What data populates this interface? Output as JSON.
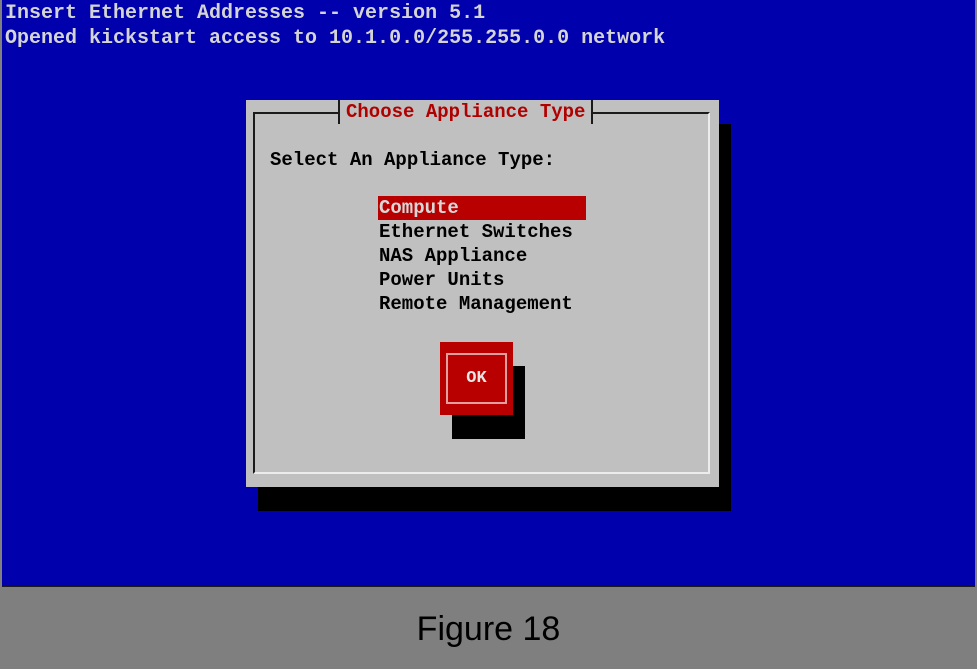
{
  "header": {
    "line1": "Insert Ethernet Addresses -- version 5.1",
    "line2": "Opened kickstart access to 10.1.0.0/255.255.0.0 network"
  },
  "dialog": {
    "title": "Choose Appliance Type",
    "prompt": "Select An Appliance Type:",
    "items": [
      {
        "label": "Compute",
        "selected": true
      },
      {
        "label": "Ethernet Switches",
        "selected": false
      },
      {
        "label": "NAS Appliance",
        "selected": false
      },
      {
        "label": "Power Units",
        "selected": false
      },
      {
        "label": "Remote Management",
        "selected": false
      }
    ],
    "ok_label": "OK"
  },
  "caption": "Figure 18",
  "colors": {
    "screen": "#0000ad",
    "dialog": "#c0c0c0",
    "accent": "#b80000",
    "title_text": "#b00000"
  }
}
